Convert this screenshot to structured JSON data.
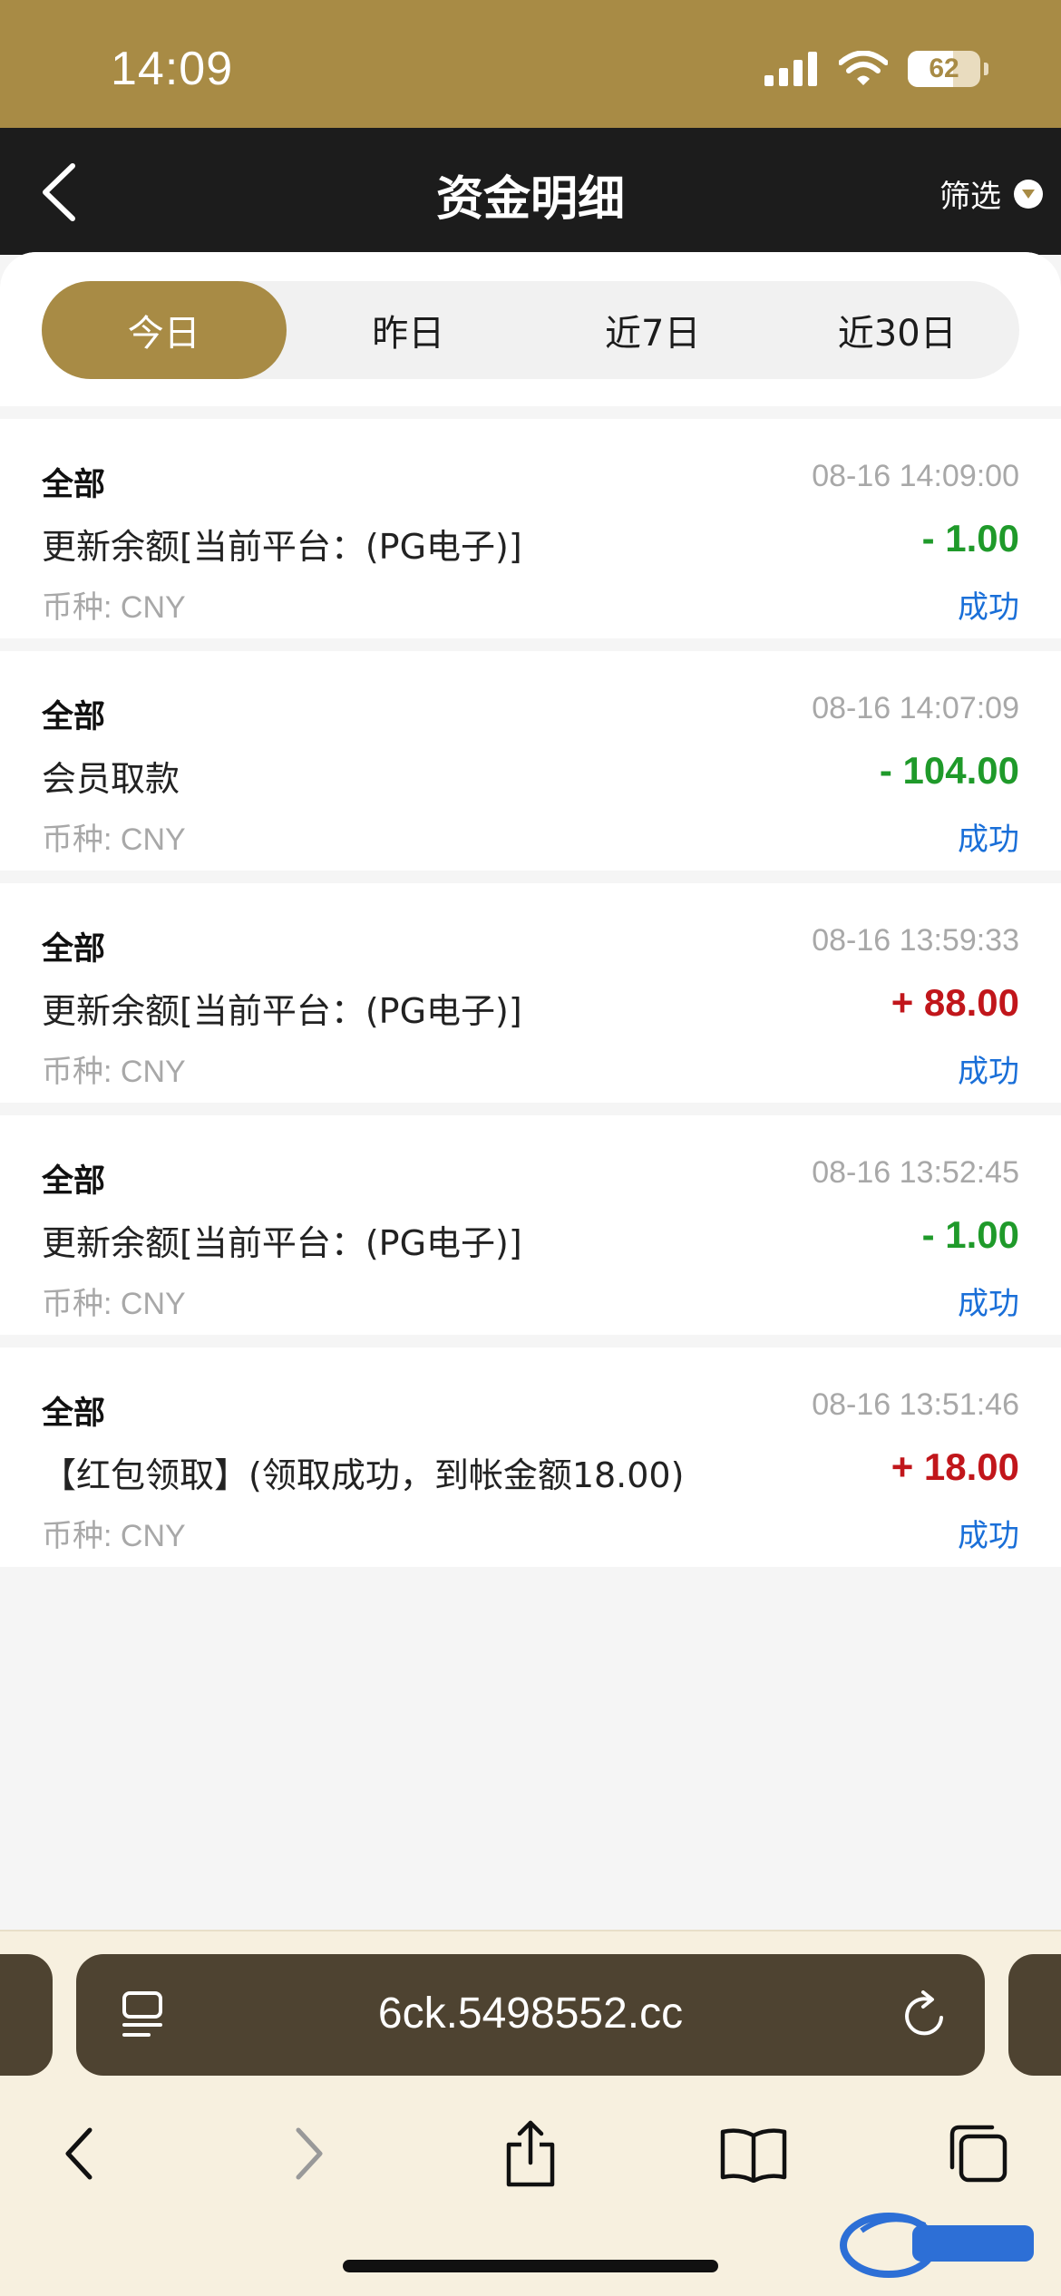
{
  "status_bar": {
    "time": "14:09",
    "battery": "62",
    "battery_level": 0.62
  },
  "nav": {
    "title": "资金明细",
    "filter_label": "筛选"
  },
  "tabs": [
    {
      "label": "今日",
      "active": true
    },
    {
      "label": "昨日",
      "active": false
    },
    {
      "label": "近7日",
      "active": false
    },
    {
      "label": "近30日",
      "active": false
    }
  ],
  "transactions": [
    {
      "type": "全部",
      "time": "08-16 14:09:00",
      "description": "更新余额[当前平台：(PG电子)]",
      "amount": "- 1.00",
      "direction": "neg",
      "currency": "币种: CNY",
      "status": "成功"
    },
    {
      "type": "全部",
      "time": "08-16 14:07:09",
      "description": "会员取款",
      "amount": "- 104.00",
      "direction": "neg",
      "currency": "币种: CNY",
      "status": "成功"
    },
    {
      "type": "全部",
      "time": "08-16 13:59:33",
      "description": "更新余额[当前平台：(PG电子)]",
      "amount": "+ 88.00",
      "direction": "pos",
      "currency": "币种: CNY",
      "status": "成功"
    },
    {
      "type": "全部",
      "time": "08-16 13:52:45",
      "description": "更新余额[当前平台：(PG电子)]",
      "amount": "- 1.00",
      "direction": "neg",
      "currency": "币种: CNY",
      "status": "成功"
    },
    {
      "type": "全部",
      "time": "08-16 13:51:46",
      "description": "【红包领取】(领取成功，到帐金额18.00)",
      "amount": "+ 18.00",
      "direction": "pos",
      "currency": "币种: CNY",
      "status": "成功"
    }
  ],
  "browser": {
    "url": "6ck.5498552.cc"
  },
  "colors": {
    "brand_gold": "#a88b45",
    "negative": "#1f9a2a",
    "positive": "#c1161b",
    "status_link": "#1a6fd8"
  }
}
